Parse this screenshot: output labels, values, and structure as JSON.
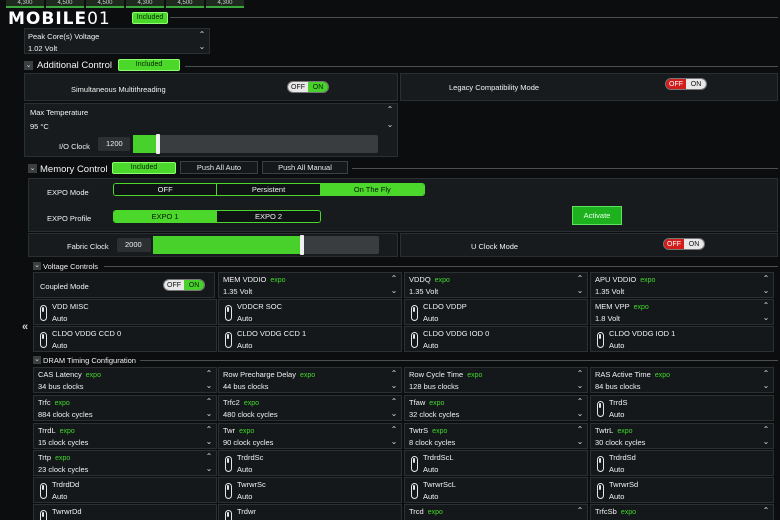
{
  "top_values": [
    "4,300",
    "4,500",
    "4,500",
    "4,300",
    "4,500",
    "4,300"
  ],
  "logo": {
    "brand_a": "MOBILE",
    "brand_b": "01"
  },
  "peak_voltage": {
    "included_label": "Included",
    "label": "Peak Core(s) Voltage",
    "value": "1.02 Volt"
  },
  "additional_control": {
    "title": "Additional Control",
    "badge": "Included",
    "smt_label": "Simultaneous Multithreading",
    "smt_toggle": {
      "off": "OFF",
      "on": "ON",
      "state": "on"
    },
    "legacy_label": "Legacy Compatibility Mode",
    "legacy_toggle": {
      "off": "OFF",
      "on": "ON",
      "state": "off"
    },
    "max_temp_label": "Max Temperature",
    "max_temp_value": "95 °C",
    "io_clock_label": "I/O Clock",
    "io_clock_value": "1200",
    "io_clock_fill": 0.1
  },
  "memory_control": {
    "title": "Memory Control",
    "badge": "Included",
    "push_auto": "Push All Auto",
    "push_manual": "Push All Manual",
    "expo_mode_label": "EXPO Mode",
    "expo_mode_options": [
      "OFF",
      "Persistent",
      "On The Fly"
    ],
    "expo_profile_label": "EXPO Profile",
    "expo_profile_options": [
      "EXPO 1",
      "EXPO 2"
    ],
    "activate_label": "Activate",
    "fabric_clock_label": "Fabric Clock",
    "fabric_clock_value": "2000",
    "fabric_clock_fill": 0.66,
    "uclock_label": "U Clock Mode",
    "uclock_toggle": {
      "off": "OFF",
      "on": "ON",
      "state": "off"
    }
  },
  "voltage_controls": {
    "title": "Voltage Controls",
    "coupled_label": "Coupled Mode",
    "coupled_toggle": {
      "off": "OFF",
      "on": "ON",
      "state": "on"
    },
    "expo_tag": "expo",
    "cells": [
      {
        "label": "MEM VDDIO",
        "expo": true,
        "value": "1.35  Volt",
        "kind": "num"
      },
      {
        "label": "VDDQ",
        "expo": true,
        "value": "1.35  Volt",
        "kind": "num"
      },
      {
        "label": "APU VDDIO",
        "expo": true,
        "value": "1.35  Volt",
        "kind": "num"
      },
      {
        "label": "VDD MISC",
        "expo": false,
        "value": "Auto",
        "kind": "sw"
      },
      {
        "label": "VDDCR SOC",
        "expo": false,
        "value": "Auto",
        "kind": "sw"
      },
      {
        "label": "CLDO VDDP",
        "expo": false,
        "value": "Auto",
        "kind": "sw"
      },
      {
        "label": "MEM VPP",
        "expo": true,
        "value": "1.8  Volt",
        "kind": "num"
      },
      {
        "label": "CLDO VDDG CCD 0",
        "expo": false,
        "value": "Auto",
        "kind": "sw"
      },
      {
        "label": "CLDO VDDG CCD 1",
        "expo": false,
        "value": "Auto",
        "kind": "sw"
      },
      {
        "label": "CLDO VDDG IOD 0",
        "expo": false,
        "value": "Auto",
        "kind": "sw"
      },
      {
        "label": "CLDO VDDG IOD 1",
        "expo": false,
        "value": "Auto",
        "kind": "sw"
      }
    ]
  },
  "dram_timing": {
    "title": "DRAM Timing Configuration",
    "cells": [
      {
        "label": "CAS Latency",
        "expo": true,
        "value": "34  bus clocks",
        "kind": "num"
      },
      {
        "label": "Row Precharge Delay",
        "expo": true,
        "value": "44  bus clocks",
        "kind": "num"
      },
      {
        "label": "Row Cycle Time",
        "expo": true,
        "value": "128  bus clocks",
        "kind": "num"
      },
      {
        "label": "RAS Active Time",
        "expo": true,
        "value": "84  bus clocks",
        "kind": "num"
      },
      {
        "label": "Trfc",
        "expo": true,
        "value": "884  clock cycles",
        "kind": "num"
      },
      {
        "label": "Trfc2",
        "expo": true,
        "value": "480  clock cycles",
        "kind": "num"
      },
      {
        "label": "Tfaw",
        "expo": true,
        "value": "32  clock cycles",
        "kind": "num"
      },
      {
        "label": "TrrdS",
        "expo": false,
        "value": "Auto",
        "kind": "sw"
      },
      {
        "label": "TrrdL",
        "expo": true,
        "value": "15  clock cycles",
        "kind": "num"
      },
      {
        "label": "Twr",
        "expo": true,
        "value": "90  clock cycles",
        "kind": "num"
      },
      {
        "label": "TwtrS",
        "expo": true,
        "value": "8  clock cycles",
        "kind": "num"
      },
      {
        "label": "TwtrL",
        "expo": true,
        "value": "30  clock cycles",
        "kind": "num"
      },
      {
        "label": "Trtp",
        "expo": true,
        "value": "23  clock cycles",
        "kind": "num"
      },
      {
        "label": "TrdrdSc",
        "expo": false,
        "value": "Auto",
        "kind": "sw"
      },
      {
        "label": "TrdrdScL",
        "expo": false,
        "value": "Auto",
        "kind": "sw"
      },
      {
        "label": "TrdrdSd",
        "expo": false,
        "value": "Auto",
        "kind": "sw"
      },
      {
        "label": "TrdrdDd",
        "expo": false,
        "value": "Auto",
        "kind": "sw"
      },
      {
        "label": "TwrwrSc",
        "expo": false,
        "value": "Auto",
        "kind": "sw"
      },
      {
        "label": "TwrwrScL",
        "expo": false,
        "value": "Auto",
        "kind": "sw"
      },
      {
        "label": "TwrwrSd",
        "expo": false,
        "value": "Auto",
        "kind": "sw"
      },
      {
        "label": "TwrwrDd",
        "expo": false,
        "value": "",
        "kind": "sw"
      },
      {
        "label": "Trdwr",
        "expo": false,
        "value": "",
        "kind": "sw"
      },
      {
        "label": "Trcd",
        "expo": true,
        "value": "",
        "kind": "num"
      },
      {
        "label": "TrfcSb",
        "expo": true,
        "value": "",
        "kind": "num"
      }
    ]
  },
  "colors": {
    "accent": "#4bd82a",
    "off_red": "#d21d1d",
    "panel": "#181b1d"
  },
  "icons": {
    "collapse": "chevron-down-icon",
    "side": "double-chevron-left-icon",
    "up": "chevron-up-icon",
    "down": "chevron-down-icon"
  }
}
